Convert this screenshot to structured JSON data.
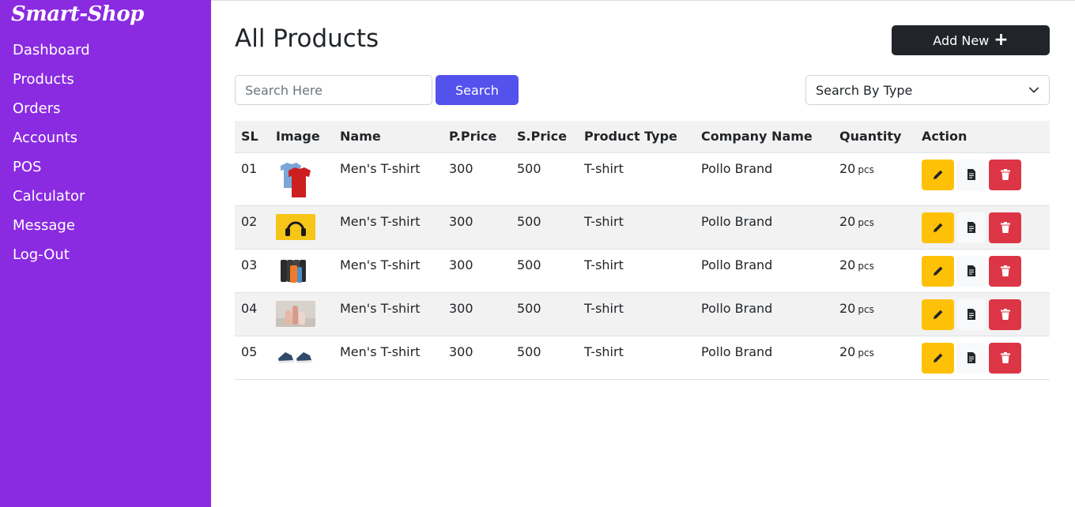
{
  "brand": "Smart-Shop",
  "nav": [
    "Dashboard",
    "Products",
    "Orders",
    "Accounts",
    "POS",
    "Calculator",
    "Message",
    "Log-Out"
  ],
  "page": {
    "title": "All Products",
    "add_button": "Add New"
  },
  "search": {
    "placeholder": "Search Here",
    "button": "Search",
    "type_select": "Search By Type"
  },
  "table": {
    "headers": [
      "SL",
      "Image",
      "Name",
      "P.Price",
      "S.Price",
      "Product Type",
      "Company Name",
      "Quantity",
      "Action"
    ],
    "rows": [
      {
        "sl": "01",
        "image": "t-shirt",
        "name": "Men's T-shirt",
        "pprice": "300",
        "sprice": "500",
        "type": "T-shirt",
        "company": "Pollo Brand",
        "qty": "20",
        "unit": "pcs"
      },
      {
        "sl": "02",
        "image": "headphones",
        "name": "Men's T-shirt",
        "pprice": "300",
        "sprice": "500",
        "type": "T-shirt",
        "company": "Pollo Brand",
        "qty": "20",
        "unit": "pcs"
      },
      {
        "sl": "03",
        "image": "bottles",
        "name": "Men's T-shirt",
        "pprice": "300",
        "sprice": "500",
        "type": "T-shirt",
        "company": "Pollo Brand",
        "qty": "20",
        "unit": "pcs"
      },
      {
        "sl": "04",
        "image": "cosmetics",
        "name": "Men's T-shirt",
        "pprice": "300",
        "sprice": "500",
        "type": "T-shirt",
        "company": "Pollo Brand",
        "qty": "20",
        "unit": "pcs"
      },
      {
        "sl": "05",
        "image": "sneakers",
        "name": "Men's T-shirt",
        "pprice": "300",
        "sprice": "500",
        "type": "T-shirt",
        "company": "Pollo Brand",
        "qty": "20",
        "unit": "pcs"
      }
    ]
  },
  "colors": {
    "sidebar": "#8a2be2",
    "search_button": "#5352ed",
    "edit": "#ffc107",
    "delete": "#dc3545",
    "dark": "#212529"
  }
}
